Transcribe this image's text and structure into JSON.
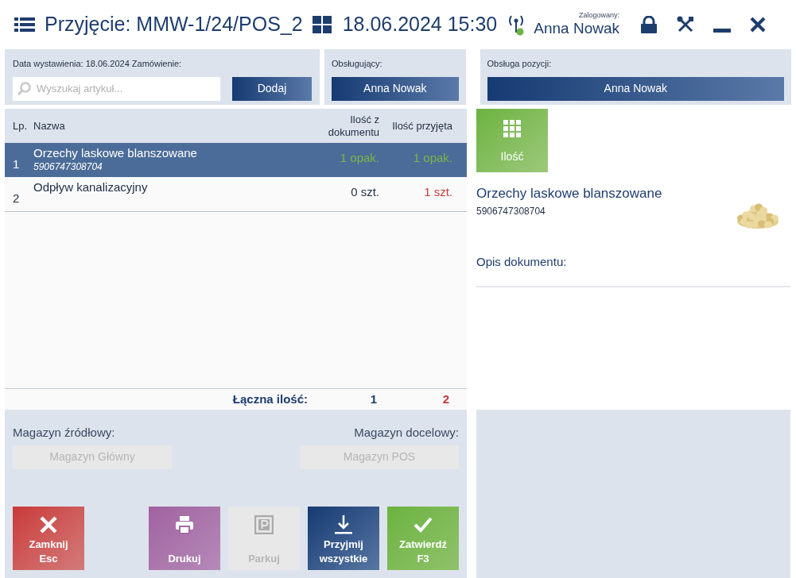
{
  "header": {
    "title": "Przyjęcie: MMW-1/24/POS_2",
    "date_time": "18.06.2024 15:30",
    "logged_label": "Zalogowany:",
    "user": "Anna Nowak",
    "connected": true
  },
  "document_panel": {
    "label": "Data wystawienia: 18.06.2024 Zamówienie:",
    "search": {
      "placeholder": "Wyszukaj artykuł..."
    },
    "add_button": "Dodaj"
  },
  "operator_panel": {
    "label": "Obsługujący:",
    "value": "Anna Nowak"
  },
  "position_panel": {
    "label": "Obsługa pozycji:",
    "value": "Anna Nowak"
  },
  "table": {
    "columns": [
      "Lp.",
      "Nazwa",
      "Ilość z dokumentu",
      "Ilość przyjęta"
    ],
    "rows": [
      {
        "lp": "1",
        "name": "Orzechy laskowe blanszowane",
        "code": "5906747308704",
        "selected": true,
        "qty_doc": {
          "text": "1 opak.",
          "color": "#7ab648"
        },
        "qty_received": {
          "text": "1 opak.",
          "color": "#7ab648"
        }
      },
      {
        "lp": "2",
        "name": "Odpływ kanalizacyjny",
        "selected": false,
        "qty_doc": {
          "text": "0 szt.",
          "color": "#1f2d45"
        },
        "qty_received": {
          "text": "1 szt.",
          "color": "#c93a3a"
        }
      }
    ],
    "total": {
      "label": "Łączna ilość:",
      "values": [
        {
          "text": "1",
          "color": "#1d3d6e"
        },
        {
          "text": "2",
          "color": "#c93a3a"
        }
      ]
    }
  },
  "item_detail": {
    "quantity_button": "Ilość",
    "name": "Orzechy laskowe blanszowane",
    "code": "5906747308704",
    "description_label": "Opis dokumentu:"
  },
  "warehouses": {
    "source": {
      "label": "Magazyn źródłowy:",
      "value": "Magazyn Główny",
      "disabled": true
    },
    "target": {
      "label": "Magazyn docelowy:",
      "value": "Magazyn POS",
      "disabled": true
    }
  },
  "actions": [
    {
      "kind": "close",
      "lines": [
        "Zamknij",
        "Esc"
      ],
      "disabled": false
    },
    {
      "kind": "print",
      "lines": [
        "Drukuj"
      ],
      "disabled": false
    },
    {
      "kind": "park",
      "lines": [
        "Parkuj"
      ],
      "disabled": true
    },
    {
      "kind": "accept_all",
      "lines": [
        "Przyjmij",
        "wszystkie"
      ],
      "disabled": false
    },
    {
      "kind": "confirm",
      "lines": [
        "Zatwierdź",
        "F3"
      ],
      "disabled": false
    }
  ]
}
